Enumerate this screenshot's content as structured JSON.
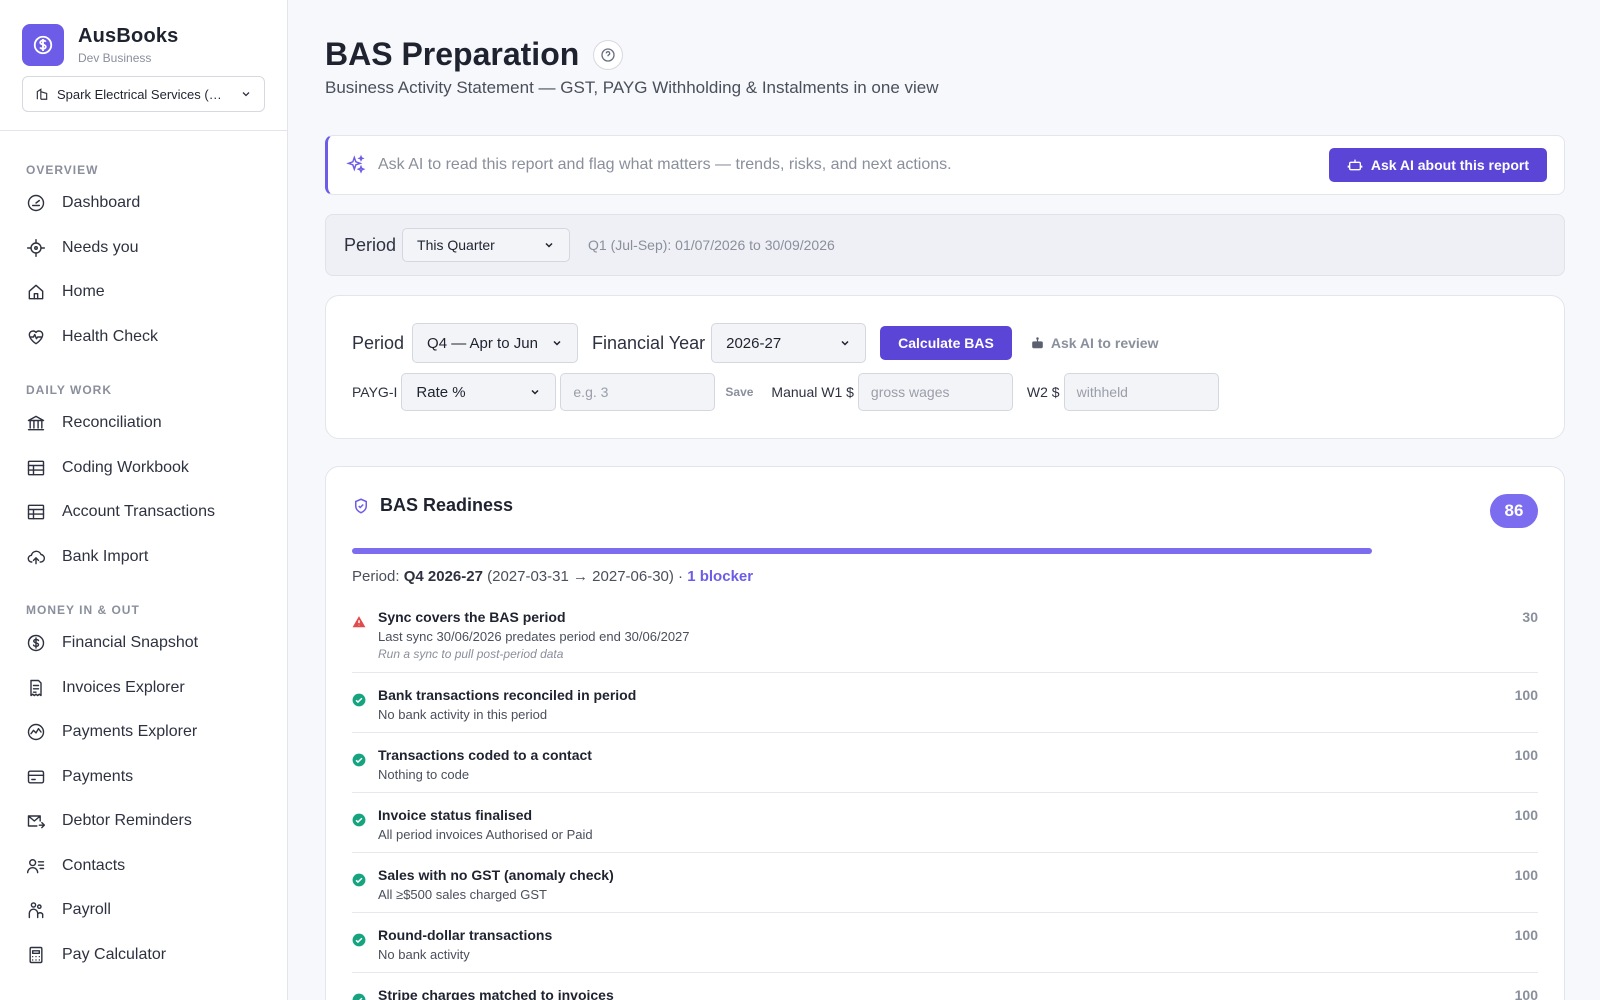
{
  "brand": {
    "name": "AusBooks",
    "sub": "Dev Business"
  },
  "org": {
    "label": "Spark Electrical Services (…"
  },
  "nav": {
    "sections": [
      {
        "title": "OVERVIEW",
        "items": [
          {
            "label": "Dashboard",
            "icon": "gauge-icon"
          },
          {
            "label": "Needs you",
            "icon": "crosshair-icon"
          },
          {
            "label": "Home",
            "icon": "home-icon"
          },
          {
            "label": "Health Check",
            "icon": "heart-pulse-icon"
          }
        ]
      },
      {
        "title": "DAILY WORK",
        "items": [
          {
            "label": "Reconciliation",
            "icon": "bank-icon"
          },
          {
            "label": "Coding Workbook",
            "icon": "table-icon"
          },
          {
            "label": "Account Transactions",
            "icon": "table-icon"
          },
          {
            "label": "Bank Import",
            "icon": "cloud-upload-icon"
          }
        ]
      },
      {
        "title": "MONEY IN & OUT",
        "items": [
          {
            "label": "Financial Snapshot",
            "icon": "dollar-circle-icon"
          },
          {
            "label": "Invoices Explorer",
            "icon": "receipt-icon"
          },
          {
            "label": "Payments Explorer",
            "icon": "chart-circle-icon"
          },
          {
            "label": "Payments",
            "icon": "card-icon"
          },
          {
            "label": "Debtor Reminders",
            "icon": "mail-send-icon"
          },
          {
            "label": "Contacts",
            "icon": "users-list-icon"
          },
          {
            "label": "Payroll",
            "icon": "people-icon"
          },
          {
            "label": "Pay Calculator",
            "icon": "calculator-icon"
          }
        ]
      }
    ]
  },
  "page": {
    "title": "BAS Preparation",
    "subtitle": "Business Activity Statement — GST, PAYG Withholding & Instalments in one view"
  },
  "ai": {
    "prompt": "Ask AI to read this report and flag what matters — trends, risks, and next actions.",
    "button": "Ask AI about this report"
  },
  "period_bar": {
    "label": "Period",
    "selected": "This Quarter",
    "range": "Q1 (Jul-Sep): 01/07/2026 to 30/09/2026"
  },
  "calc": {
    "period_label": "Period",
    "period_value": "Q4 — Apr to Jun",
    "fy_label": "Financial Year",
    "fy_value": "2026-27",
    "calc_button": "Calculate BAS",
    "review_link": "Ask AI to review",
    "paygi_label": "PAYG-I",
    "paygi_mode": "Rate %",
    "paygi_placeholder": "e.g. 3",
    "save_label": "Save",
    "w1_label": "Manual W1 $",
    "w1_placeholder": "gross wages",
    "w2_label": "W2 $",
    "w2_placeholder": "withheld"
  },
  "readiness": {
    "title": "BAS Readiness",
    "score": "86",
    "progress": 0.86,
    "period_prefix": "Period: ",
    "period_bold": "Q4 2026-27",
    "period_dates": " (2027-03-31 → 2027-06-30) · ",
    "blocker": "1 blocker",
    "checks": [
      {
        "status": "warning",
        "title": "Sync covers the BAS period",
        "desc": "Last sync 30/06/2026 predates period end 30/06/2027",
        "note": "Run a sync to pull post-period data",
        "score": "30"
      },
      {
        "status": "ok",
        "title": "Bank transactions reconciled in period",
        "desc": "No bank activity in this period",
        "score": "100"
      },
      {
        "status": "ok",
        "title": "Transactions coded to a contact",
        "desc": "Nothing to code",
        "score": "100"
      },
      {
        "status": "ok",
        "title": "Invoice status finalised",
        "desc": "All period invoices Authorised or Paid",
        "score": "100"
      },
      {
        "status": "ok",
        "title": "Sales with no GST (anomaly check)",
        "desc": "All ≥$500 sales charged GST",
        "score": "100"
      },
      {
        "status": "ok",
        "title": "Round-dollar transactions",
        "desc": "No bank activity",
        "score": "100"
      },
      {
        "status": "ok",
        "title": "Stripe charges matched to invoices",
        "desc": "",
        "score": "100"
      }
    ]
  },
  "colors": {
    "accent": "#5b45d6",
    "accent_light": "#7b6cf0",
    "ok": "#16a37f",
    "warning": "#e04b4b"
  }
}
